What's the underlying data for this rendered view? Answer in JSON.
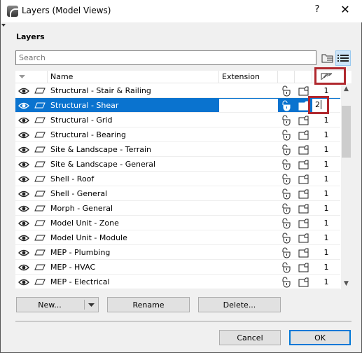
{
  "window": {
    "title": "Layers (Model Views)",
    "help": "?",
    "close": "✕"
  },
  "section_label": "Layers",
  "search": {
    "placeholder": "Search",
    "value": ""
  },
  "columns": {
    "name": "Name",
    "extension": "Extension"
  },
  "rows": [
    {
      "name": "Structural - Stair & Railing",
      "number": "1",
      "selected": false
    },
    {
      "name": "Structural - Shear",
      "number": "2",
      "selected": true
    },
    {
      "name": "Structural - Grid",
      "number": "1",
      "selected": false
    },
    {
      "name": "Structural - Bearing",
      "number": "1",
      "selected": false
    },
    {
      "name": "Site & Landscape - Terrain",
      "number": "1",
      "selected": false
    },
    {
      "name": "Site & Landscape - General",
      "number": "1",
      "selected": false
    },
    {
      "name": "Shell - Roof",
      "number": "1",
      "selected": false
    },
    {
      "name": "Shell - General",
      "number": "1",
      "selected": false
    },
    {
      "name": "Morph - General",
      "number": "1",
      "selected": false
    },
    {
      "name": "Model Unit - Zone",
      "number": "1",
      "selected": false
    },
    {
      "name": "Model Unit - Module",
      "number": "1",
      "selected": false
    },
    {
      "name": "MEP - Plumbing",
      "number": "1",
      "selected": false
    },
    {
      "name": "MEP - HVAC",
      "number": "1",
      "selected": false
    },
    {
      "name": "MEP - Electrical",
      "number": "1",
      "selected": false
    }
  ],
  "buttons": {
    "new": "New...",
    "rename": "Rename",
    "delete": "Delete...",
    "cancel": "Cancel",
    "ok": "OK"
  },
  "colors": {
    "selection": "#0a73cf",
    "highlight": "#b0282e",
    "default_button": "#0078d7"
  }
}
